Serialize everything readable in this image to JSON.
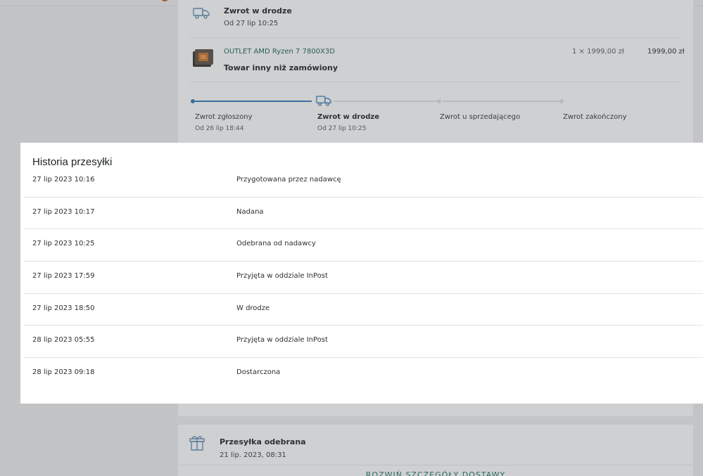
{
  "order_card": {
    "current_status": {
      "title": "Zwrot w drodze",
      "since": "Od 27 lip 10:25",
      "icon": "truck-icon"
    },
    "item": {
      "name": "OUTLET AMD Ryzen 7 7800X3D",
      "reason": "Towar inny niż zamówiony",
      "quantity_price": "1 × 1999,00 zł",
      "total": "1999,00 zł"
    },
    "progress": {
      "steps": [
        {
          "label": "Zwrot zgłoszony",
          "date": "Od 26 lip 18:44",
          "state": "done"
        },
        {
          "label": "Zwrot w drodze",
          "date": "Od 27 lip 10:25",
          "state": "current"
        },
        {
          "label": "Zwrot u sprzedającego",
          "date": "",
          "state": "pending"
        },
        {
          "label": "Zwrot zakończony",
          "date": "",
          "state": "pending"
        }
      ]
    }
  },
  "receipt_card": {
    "title": "Przesyłka odebrana",
    "date": "21 lip. 2023, 08:31",
    "details_link": "ROZWIŃ SZCZEGÓŁY DOSTAWY",
    "icon": "package-icon"
  },
  "history_modal": {
    "title": "Historia przesyłki",
    "events": [
      {
        "date": "27 lip 2023 10:16",
        "status": "Przygotowana przez nadawcę"
      },
      {
        "date": "27 lip 2023 10:17",
        "status": "Nadana"
      },
      {
        "date": "27 lip 2023 10:25",
        "status": "Odebrana od nadawcy"
      },
      {
        "date": "27 lip 2023 17:59",
        "status": "Przyjęta w oddziale InPost"
      },
      {
        "date": "27 lip 2023 18:50",
        "status": "W drodze"
      },
      {
        "date": "28 lip 2023 05:55",
        "status": "Przyjęta w oddziale InPost"
      },
      {
        "date": "28 lip 2023 09:18",
        "status": "Dostarczona"
      }
    ]
  },
  "colors": {
    "overlay": "#c3c4c6",
    "accent_blue": "#3a6fa0",
    "accent_green": "#2d6b60",
    "modal_bg": "#ffffff"
  }
}
